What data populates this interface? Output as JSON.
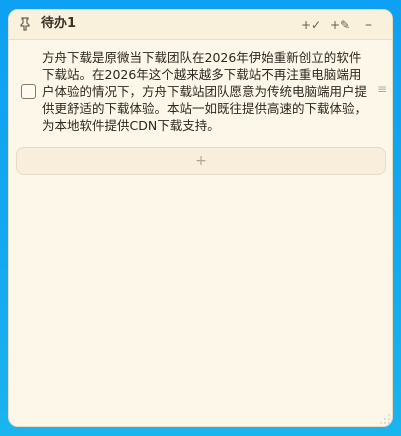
{
  "window": {
    "title": "待办1"
  },
  "toolbar": {
    "add_check_label": "+✓",
    "add_edit_label": "+✎",
    "minimize_label": "–"
  },
  "task": {
    "checked": false,
    "text": "方舟下载是原微当下载团队在2026年伊始重新创立的软件下载站。在2026年这个越来越多下载站不再注重电脑端用户体验的情况下，方舟下载站团队愿意为传统电脑端用户提供更舒适的下载体验。本站一如既往提供高速的下载体验，为本地软件提供CDN下载支持。",
    "drag_handle": "≡"
  },
  "add_task": {
    "label": "+"
  },
  "icons": {
    "pin": "pin-icon",
    "drag": "drag-handle-icon",
    "resize": "resize-grip-icon"
  },
  "colors": {
    "background": "#14a3ee",
    "window": "#fdf7e9",
    "titlebar": "#faf1dd",
    "text": "#2f261f",
    "muted": "#b2a693"
  }
}
